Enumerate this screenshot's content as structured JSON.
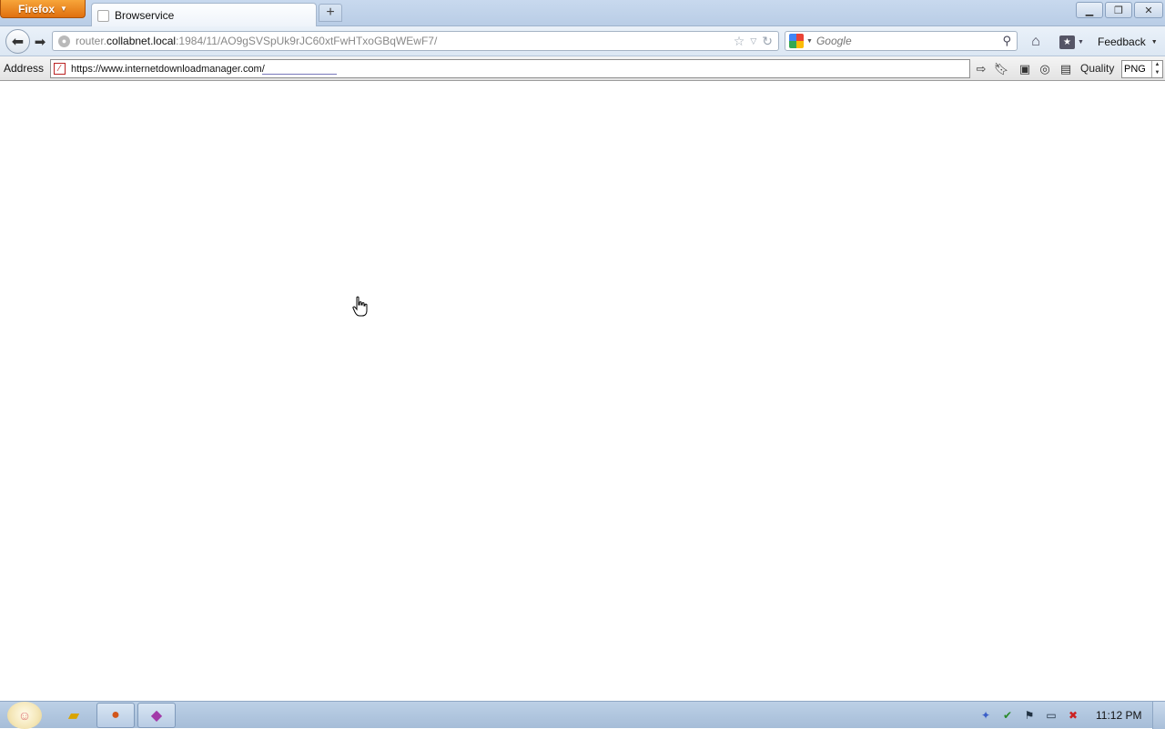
{
  "browser": {
    "menu_button": "Firefox",
    "tab_title": "Browservice",
    "url_dim_prefix": "router.",
    "url_host": "collabnet.local",
    "url_path": ":1984/11/AO9gSVSpUk9rJC60xtFwHTxoGBqWEwF7/",
    "search_placeholder": "Google",
    "feedback_label": "Feedback"
  },
  "address_toolbar": {
    "label": "Address",
    "url_value": "https://www.internetdownloadmanager.com/",
    "quality_label": "Quality",
    "format_value": "PNG"
  },
  "taskbar": {
    "clock": "11:12 PM"
  },
  "icons": {
    "back": "arrow-left-icon",
    "forward": "arrow-right-icon",
    "home": "home-icon",
    "bookmarks": "bookmarks-icon",
    "reload": "reload-icon",
    "star": "star-icon",
    "search": "magnifier-icon"
  }
}
